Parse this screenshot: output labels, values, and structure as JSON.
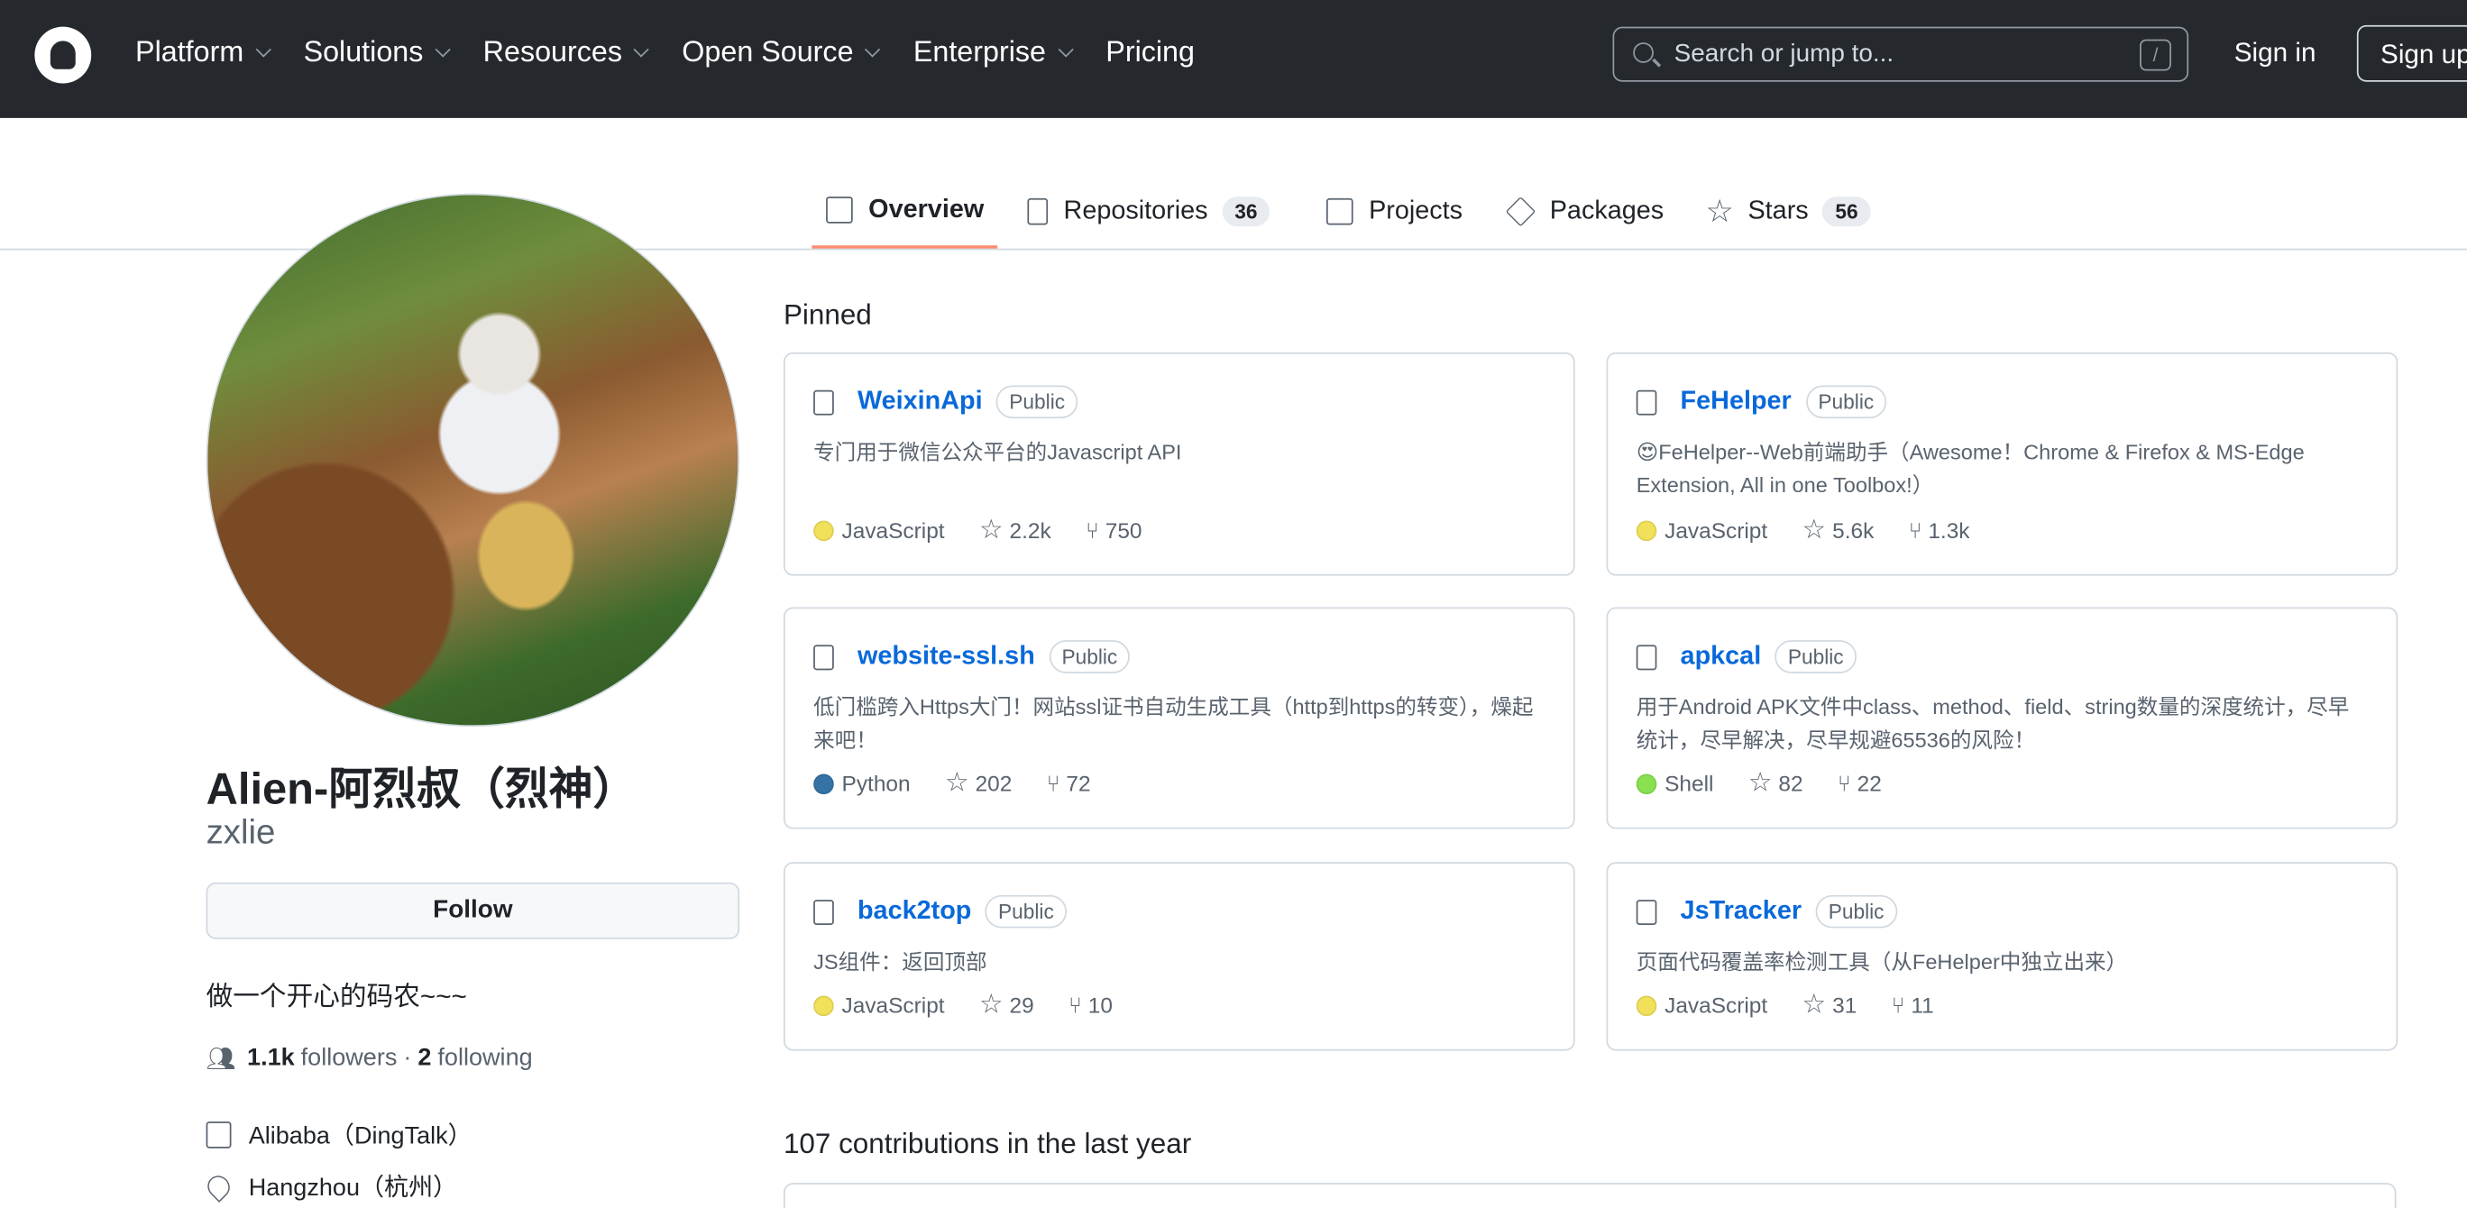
{
  "header": {
    "nav": [
      "Platform",
      "Solutions",
      "Resources",
      "Open Source",
      "Enterprise",
      "Pricing"
    ],
    "search_placeholder": "Search or jump to...",
    "search_shortcut": "/",
    "sign_in": "Sign in",
    "sign_up": "Sign up"
  },
  "tabs": [
    {
      "label": "Overview",
      "selected": true
    },
    {
      "label": "Repositories",
      "count": "36"
    },
    {
      "label": "Projects"
    },
    {
      "label": "Packages"
    },
    {
      "label": "Stars",
      "count": "56"
    }
  ],
  "profile": {
    "name": "Alien-阿烈叔（烈神）",
    "login": "zxlie",
    "follow": "Follow",
    "bio": "做一个开心的码农~~~",
    "followers": "1.1k",
    "followers_label": "followers",
    "sep": "·",
    "following": "2",
    "following_label": "following",
    "company": "Alibaba（DingTalk）",
    "location": "Hangzhou（杭州）"
  },
  "pinned": {
    "heading": "Pinned",
    "repos": [
      {
        "name": "WeixinApi",
        "visibility": "Public",
        "desc": "专门用于微信公众平台的Javascript API",
        "lang": "JavaScript",
        "color": "#f1e05a",
        "stars": "2.2k",
        "forks": "750"
      },
      {
        "name": "FeHelper",
        "visibility": "Public",
        "desc": "😍FeHelper--Web前端助手（Awesome！Chrome & Firefox & MS-Edge Extension, All in one Toolbox!）",
        "lang": "JavaScript",
        "color": "#f1e05a",
        "stars": "5.6k",
        "forks": "1.3k"
      },
      {
        "name": "website-ssl.sh",
        "visibility": "Public",
        "desc": "低门槛跨入Https大门！网站ssl证书自动生成工具（http到https的转变），燥起来吧！",
        "lang": "Python",
        "color": "#3572A5",
        "stars": "202",
        "forks": "72"
      },
      {
        "name": "apkcal",
        "visibility": "Public",
        "desc": "用于Android APK文件中class、method、field、string数量的深度统计，尽早统计，尽早解决，尽早规避65536的风险！",
        "lang": "Shell",
        "color": "#89e051",
        "stars": "82",
        "forks": "22"
      },
      {
        "name": "back2top",
        "visibility": "Public",
        "desc": "JS组件：返回顶部",
        "lang": "JavaScript",
        "color": "#f1e05a",
        "stars": "29",
        "forks": "10"
      },
      {
        "name": "JsTracker",
        "visibility": "Public",
        "desc": "页面代码覆盖率检测工具（从FeHelper中独立出来）",
        "lang": "JavaScript",
        "color": "#f1e05a",
        "stars": "31",
        "forks": "11"
      }
    ]
  },
  "contributions": {
    "heading": "107 contributions in the last year"
  }
}
